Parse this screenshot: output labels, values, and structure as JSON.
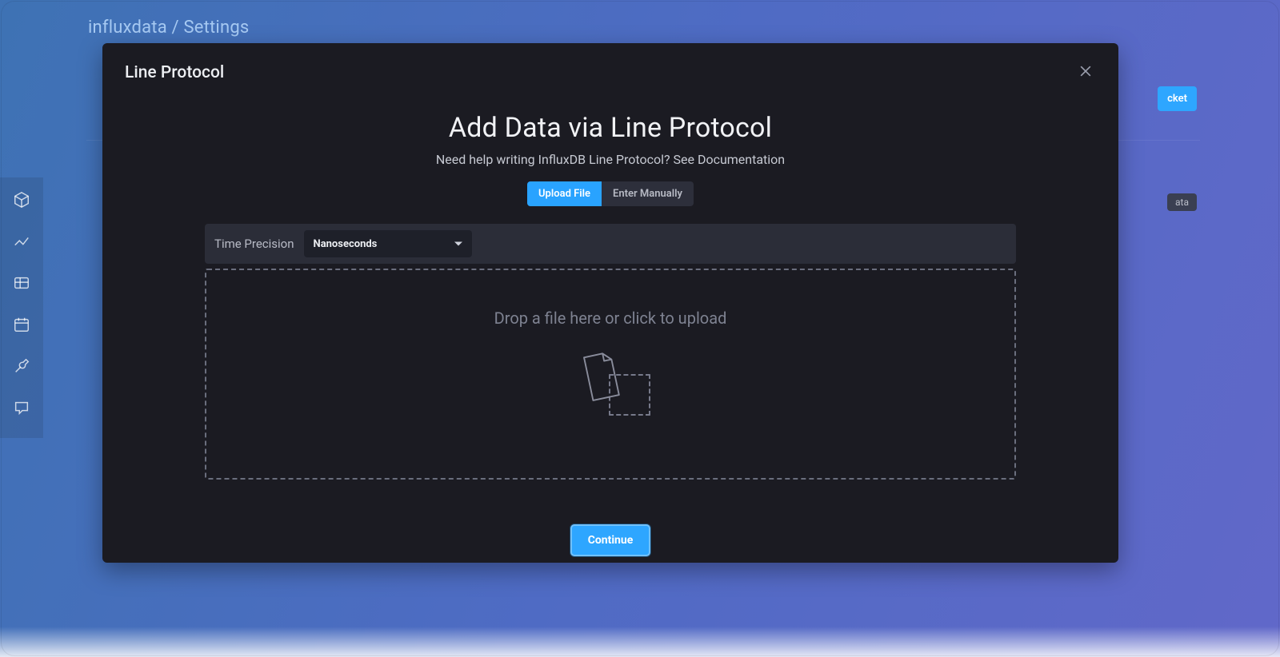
{
  "breadcrumb": {
    "org": "influxdata",
    "sep": "/",
    "page": "Settings"
  },
  "sidebar_icons": [
    "cube-icon",
    "graph-icon",
    "grid-icon",
    "calendar-icon",
    "wrench-icon",
    "chat-icon"
  ],
  "background": {
    "primary_button": "cket",
    "tag": "ata"
  },
  "modal": {
    "small_title": "Line Protocol",
    "heading": "Add Data via Line Protocol",
    "subheading": "Need help writing InfluxDB Line Protocol? See Documentation",
    "segmented": {
      "upload": "Upload File",
      "manual": "Enter Manually"
    },
    "precision": {
      "label": "Time Precision",
      "selected": "Nanoseconds"
    },
    "dropzone_text": "Drop a file here or click to upload",
    "continue": "Continue"
  },
  "colors": {
    "accent": "#2ea6ff",
    "modal_bg": "#1b1b22"
  }
}
